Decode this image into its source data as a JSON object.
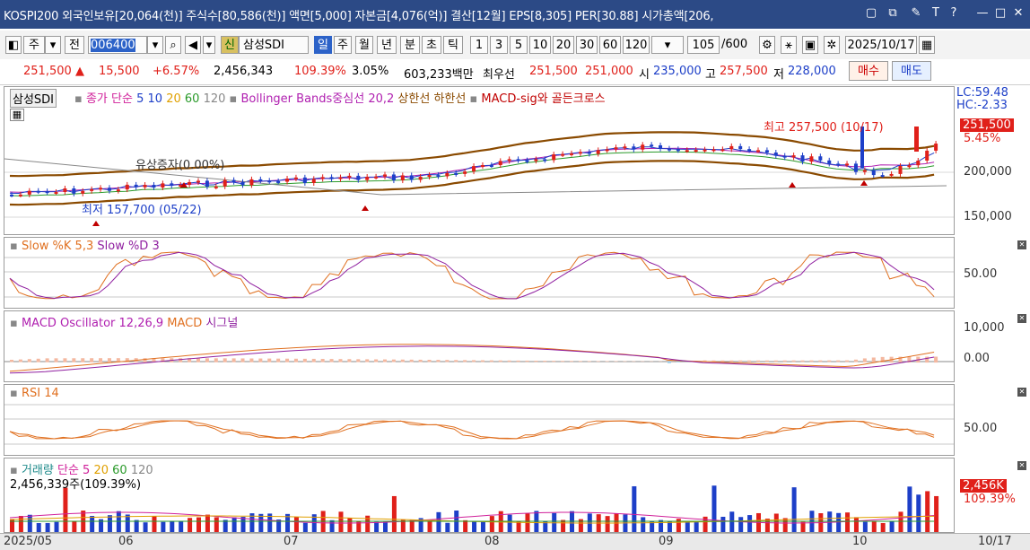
{
  "titlebar": {
    "text": "KOSPI200 외국인보유[20,064(천)] 주식수[80,586(천)] 액면[5,000] 자본금[4,076(억)] 결산[12월] EPS[8,305] PER[30.88] 시가총액[206,",
    "icons": [
      "restore-icon",
      "pin-icon",
      "edit-icon",
      "font-icon",
      "help-icon",
      "minimize-icon",
      "maximize-icon",
      "close-icon"
    ]
  },
  "toolbar": {
    "market": "주",
    "prev_label": "전",
    "code": "006400",
    "new_badge": "신",
    "name": "삼성SDI",
    "periods": [
      "일",
      "주",
      "월",
      "년",
      "분",
      "초",
      "틱"
    ],
    "selected_period": "일",
    "numbers": [
      "1",
      "3",
      "5",
      "10",
      "20",
      "30",
      "60",
      "120"
    ],
    "count": "105",
    "count_total": "/600",
    "date": "2025/10/17"
  },
  "quote": {
    "price": "251,500",
    "change": "15,500",
    "pct": "+6.57%",
    "volume": "2,456,343",
    "vol_ratio": "109.39%",
    "turnover": "3.05%",
    "amount": "603,233백만",
    "best_label": "최우선",
    "best_ask": "251,500",
    "best_bid": "251,000",
    "open_label": "시",
    "open": "235,000",
    "high_label": "고",
    "high": "257,500",
    "low_label": "저",
    "low": "228,000",
    "buy": "매수",
    "sell": "매도"
  },
  "price_pane": {
    "tab": "삼성SDI",
    "legend": [
      {
        "text": "종가 단순",
        "color": "#d0209a"
      },
      {
        "text": "5",
        "color": "#1d3fc8"
      },
      {
        "text": "10",
        "color": "#1d3fc8"
      },
      {
        "text": "20",
        "color": "#e0a000"
      },
      {
        "text": "60",
        "color": "#2a9a2a"
      },
      {
        "text": "120",
        "color": "#888888"
      },
      {
        "text": "Bollinger Bands중심선 20,2",
        "color": "#b020b0"
      },
      {
        "text": "상한선",
        "color": "#8a4a00"
      },
      {
        "text": "하한선",
        "color": "#8a4a00"
      },
      {
        "text": "MACD-sig와 골든크로스",
        "color": "#c00000"
      }
    ],
    "rights_label": "유상증자(0.00%)",
    "low_annot": "최저 157,700 (05/22)",
    "high_annot": "최고 257,500 (10/17)",
    "lc": "LC:59.48",
    "hc": "HC:-2.33",
    "last_price": "251,500",
    "last_pct": "5.45%",
    "yticks": [
      "200,000",
      "150,000"
    ]
  },
  "stoch_pane": {
    "title": "Slow %K 5,3",
    "title2": "Slow %D 3",
    "ytick": "50.00"
  },
  "macd_pane": {
    "title": "MACD Oscillator 12,26,9",
    "title2": "MACD",
    "title3": "시그널",
    "yticks": [
      "10,000",
      "0.00"
    ]
  },
  "rsi_pane": {
    "title": "RSI 14",
    "ytick": "50.00"
  },
  "vol_pane": {
    "title": "거래량",
    "ma_label": "단순 5",
    "ma20": "20",
    "ma60": "60",
    "ma120": "120",
    "summary": "2,456,339주(109.39%)",
    "last": "2,456K",
    "last_pct": "109.39%"
  },
  "xaxis": {
    "labels": [
      "2025/05",
      "06",
      "07",
      "08",
      "09",
      "10"
    ],
    "right": "10/17"
  },
  "colors": {
    "up": "#e0201a",
    "down": "#1d3fc8",
    "band": "#8a4a00"
  }
}
